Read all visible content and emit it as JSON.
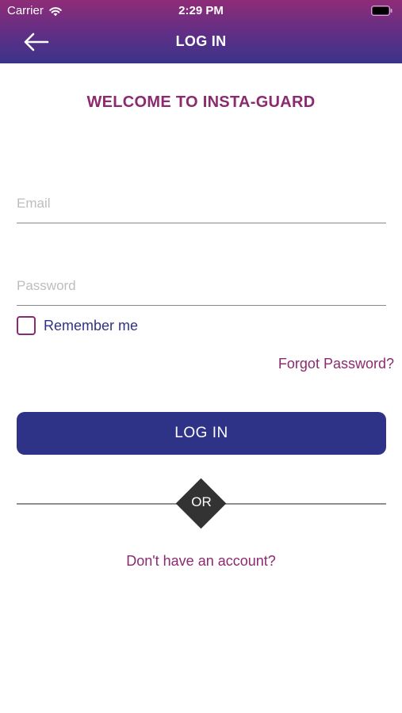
{
  "status_bar": {
    "carrier": "Carrier",
    "time": "2:29 PM",
    "icons": [
      "wifi-icon",
      "battery-icon"
    ]
  },
  "nav": {
    "title": "LOG IN",
    "back_icon": "arrow-left-icon"
  },
  "welcome": "WELCOME TO INSTA-GUARD",
  "form": {
    "email_placeholder": "Email",
    "email_value": "",
    "password_placeholder": "Password",
    "password_value": "",
    "remember_label": "Remember me",
    "remember_checked": false,
    "forgot_label": "Forgot Password?",
    "login_label": "LOG IN",
    "or_label": "OR",
    "signup_label": "Don't have an account?"
  },
  "colors": {
    "header_gradient_top": "#8f2c77",
    "header_gradient_bottom": "#3a3489",
    "accent": "#8b2a6f",
    "primary_button": "#2e3387",
    "or_badge": "#333333"
  }
}
